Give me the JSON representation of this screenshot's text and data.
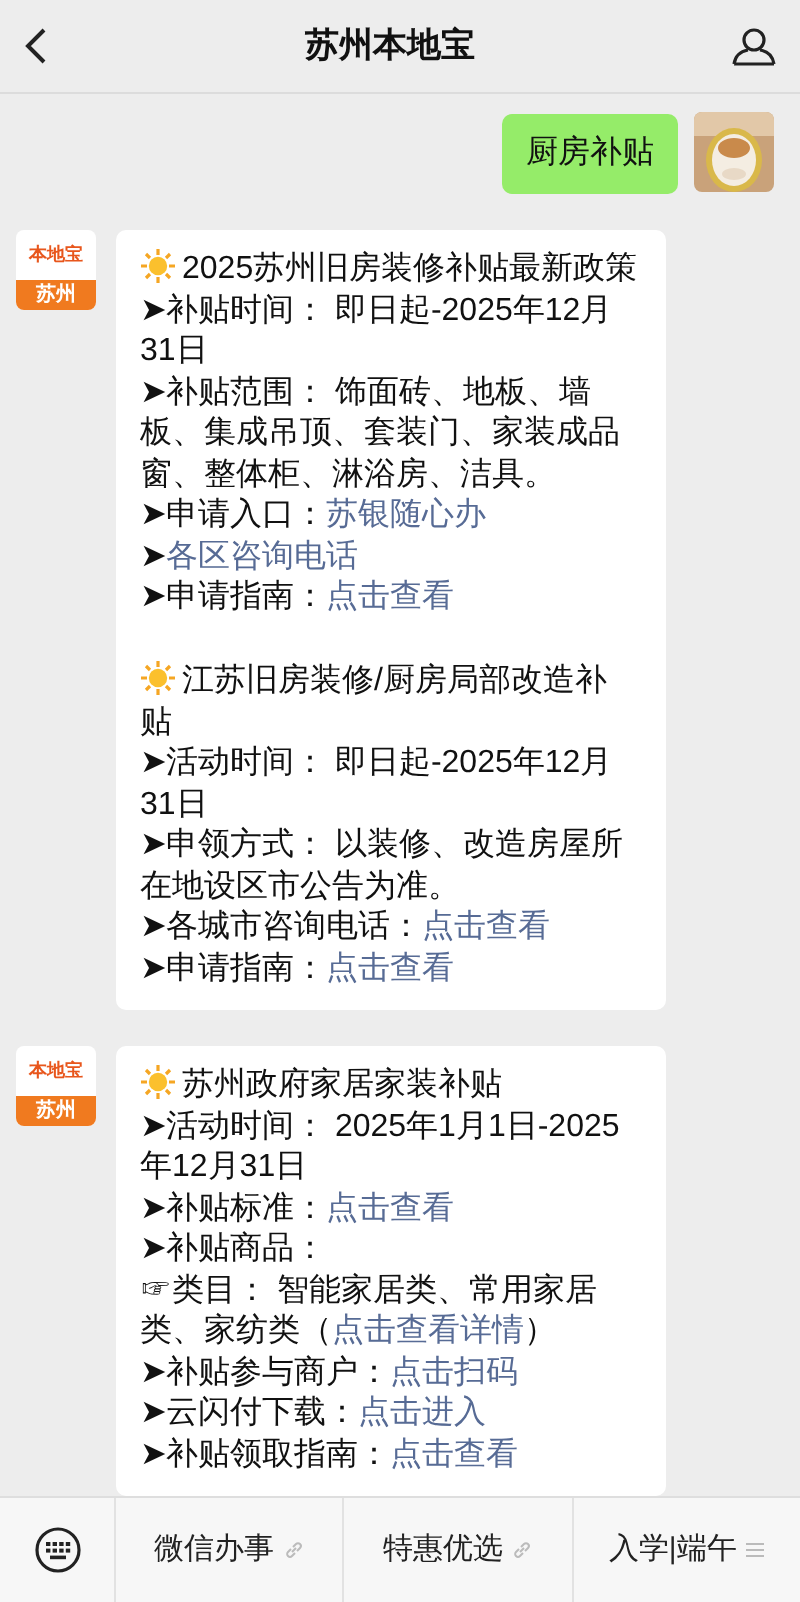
{
  "header": {
    "title": "苏州本地宝"
  },
  "messages": [
    {
      "kind": "user",
      "text": "厨房补贴"
    },
    {
      "kind": "article",
      "avatar": {
        "brand": "本地宝",
        "city": "苏州"
      },
      "sections": [
        {
          "title": "2025苏州旧房装修补贴最新政策",
          "items": [
            [
              {
                "text": "➤补贴时间： 即日起-2025年12月31日",
                "link": false
              }
            ],
            [
              {
                "text": "➤补贴范围： 饰面砖、地板、墙板、集成吊顶、套装门、家装成品窗、整体柜、淋浴房、洁具。",
                "link": false
              }
            ],
            [
              {
                "text": "➤申请入口：",
                "link": false
              },
              {
                "text": "苏银随心办",
                "link": true
              }
            ],
            [
              {
                "text": "➤",
                "link": false
              },
              {
                "text": "各区咨询电话",
                "link": true
              }
            ],
            [
              {
                "text": "➤申请指南：",
                "link": false
              },
              {
                "text": "点击查看",
                "link": true
              }
            ]
          ]
        },
        {
          "title": "江苏旧房装修/厨房局部改造补贴",
          "items": [
            [
              {
                "text": "➤活动时间： 即日起-2025年12月31日",
                "link": false
              }
            ],
            [
              {
                "text": "➤申领方式： 以装修、改造房屋所在地设区市公告为准。",
                "link": false
              }
            ],
            [
              {
                "text": "➤各城市咨询电话：",
                "link": false
              },
              {
                "text": "点击查看",
                "link": true
              }
            ],
            [
              {
                "text": "➤申请指南：",
                "link": false
              },
              {
                "text": "点击查看",
                "link": true
              }
            ]
          ]
        }
      ]
    },
    {
      "kind": "article",
      "avatar": {
        "brand": "本地宝",
        "city": "苏州"
      },
      "sections": [
        {
          "title": "苏州政府家居家装补贴",
          "items": [
            [
              {
                "text": "➤活动时间： 2025年1月1日-2025年12月31日",
                "link": false
              }
            ],
            [
              {
                "text": "➤补贴标准：",
                "link": false
              },
              {
                "text": "点击查看",
                "link": true
              }
            ],
            [
              {
                "text": "➤补贴商品：",
                "link": false
              }
            ],
            [
              {
                "text": "☞类目： 智能家居类、常用家居类、家纺类（",
                "link": false
              },
              {
                "text": "点击查看详情",
                "link": true
              },
              {
                "text": "）",
                "link": false
              }
            ],
            [
              {
                "text": "➤补贴参与商户：",
                "link": false
              },
              {
                "text": "点击扫码",
                "link": true
              }
            ],
            [
              {
                "text": "➤云闪付下载：",
                "link": false
              },
              {
                "text": "点击进入",
                "link": true
              }
            ],
            [
              {
                "text": "➤补贴领取指南：",
                "link": false
              },
              {
                "text": "点击查看",
                "link": true
              }
            ]
          ]
        }
      ]
    }
  ],
  "menu": [
    {
      "label": "微信办事",
      "kind": "link"
    },
    {
      "label": "特惠优选",
      "kind": "link"
    },
    {
      "label": "入学|端午",
      "kind": "submenu"
    }
  ]
}
